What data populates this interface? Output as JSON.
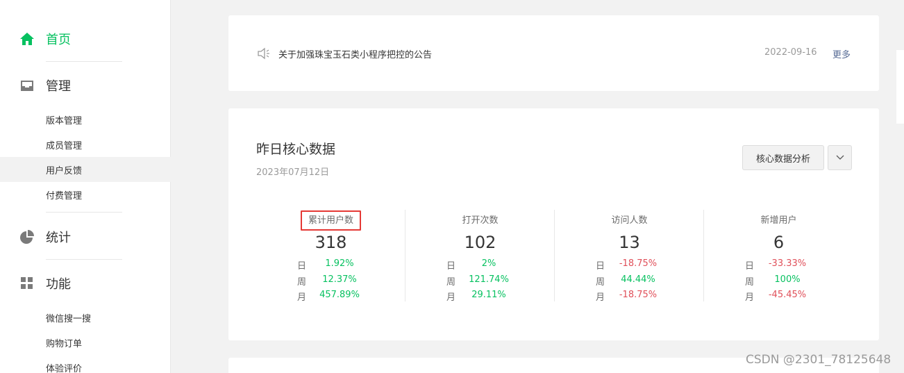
{
  "nav": {
    "home": "首页",
    "manage": "管理",
    "manage_items": [
      "版本管理",
      "成员管理",
      "用户反馈",
      "付费管理"
    ],
    "stats": "统计",
    "features": "功能",
    "feature_items": [
      "微信搜一搜",
      "购物订单",
      "体验评价"
    ]
  },
  "notice": {
    "icon": "speaker-icon",
    "title": "关于加强珠宝玉石类小程序把控的公告",
    "date": "2022-09-16",
    "more": "更多"
  },
  "stats": {
    "title": "昨日核心数据",
    "date": "2023年07月12日",
    "analysis_button": "核心数据分析",
    "dropdown_icon": "chevron-down-icon",
    "metrics": [
      {
        "label": "累计用户数",
        "value": "318",
        "rates": [
          {
            "key": "日",
            "value": "1.92%",
            "trend": "up"
          },
          {
            "key": "周",
            "value": "12.37%",
            "trend": "up"
          },
          {
            "key": "月",
            "value": "457.89%",
            "trend": "up"
          }
        ]
      },
      {
        "label": "打开次数",
        "value": "102",
        "rates": [
          {
            "key": "日",
            "value": "2%",
            "trend": "up"
          },
          {
            "key": "周",
            "value": "121.74%",
            "trend": "up"
          },
          {
            "key": "月",
            "value": "29.11%",
            "trend": "up"
          }
        ]
      },
      {
        "label": "访问人数",
        "value": "13",
        "rates": [
          {
            "key": "日",
            "value": "-18.75%",
            "trend": "down"
          },
          {
            "key": "周",
            "value": "44.44%",
            "trend": "up"
          },
          {
            "key": "月",
            "value": "-18.75%",
            "trend": "down"
          }
        ]
      },
      {
        "label": "新增用户",
        "value": "6",
        "rates": [
          {
            "key": "日",
            "value": "-33.33%",
            "trend": "down"
          },
          {
            "key": "周",
            "value": "100%",
            "trend": "up"
          },
          {
            "key": "月",
            "value": "-45.45%",
            "trend": "down"
          }
        ]
      }
    ]
  },
  "colors": {
    "accent": "#07c160",
    "negative": "#e0505a",
    "link": "#576b95",
    "highlight_box": "#e53935"
  },
  "watermark": "CSDN @2301_78125648"
}
